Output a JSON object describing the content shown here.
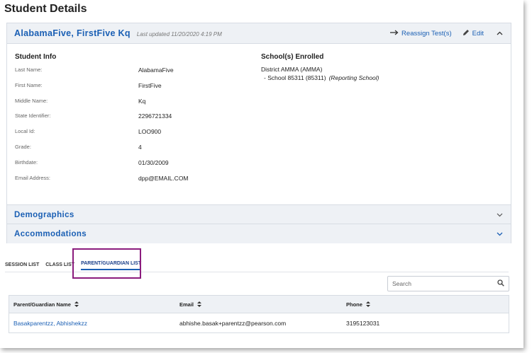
{
  "page_title": "Student Details",
  "student": {
    "name": "AlabamaFive, FirstFive Kq",
    "last_updated": "Last updated 11/20/2020 4:19 PM",
    "actions": {
      "reassign": "Reassign Test(s)",
      "edit": "Edit"
    }
  },
  "student_info": {
    "heading": "Student Info",
    "fields": [
      {
        "label": "Last Name:",
        "value": "AlabamaFive"
      },
      {
        "label": "First Name:",
        "value": "FirstFive"
      },
      {
        "label": "Middle Name:",
        "value": "Kq"
      },
      {
        "label": "State Identifier:",
        "value": "2296721334"
      },
      {
        "label": "Local Id:",
        "value": "LOO900"
      },
      {
        "label": "Grade:",
        "value": "4"
      },
      {
        "label": "Birthdate:",
        "value": "01/30/2009"
      },
      {
        "label": "Email Address:",
        "value": "dpp@EMAIL.COM"
      }
    ]
  },
  "schools": {
    "heading": "School(s) Enrolled",
    "district": "District AMMA (AMMA)",
    "school": "- School 85311 (85311)",
    "school_note": "(Reporting School)"
  },
  "accordions": {
    "demographics": "Demographics",
    "accommodations": "Accommodations"
  },
  "tabs": [
    {
      "label": "SESSION LIST",
      "active": false
    },
    {
      "label": "CLASS LIST",
      "active": false
    },
    {
      "label": "PARENT/GUARDIAN LIST",
      "active": true
    }
  ],
  "search": {
    "placeholder": "Search"
  },
  "table": {
    "columns": [
      "Parent/Guardian Name",
      "Email",
      "Phone"
    ],
    "rows": [
      {
        "name": "Basakparentzz, Abhishekzz",
        "email": "abhishe.basak+parentzz@pearson.com",
        "phone": "3195123031"
      }
    ]
  },
  "colors": {
    "accent": "#1a5fb4",
    "highlight": "#8b1c7d",
    "header_bg": "#eef1f5"
  }
}
